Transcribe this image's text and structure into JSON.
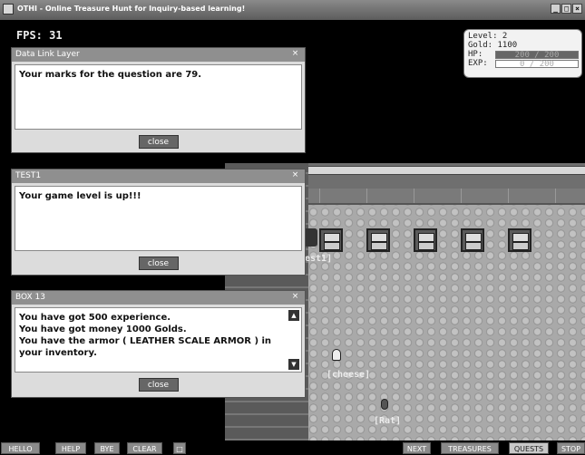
{
  "window": {
    "title": "OTHI - Online Treasure Hunt for Inquiry-based learning!",
    "min": "_",
    "max": "□",
    "close": "×"
  },
  "fps": "FPS: 31",
  "stats": {
    "level": "Level: 2",
    "gold": "Gold: 1100",
    "hp_label": "HP:",
    "hp_text": "200 / 200",
    "hp_fraction": 1.0,
    "exp_label": "EXP:",
    "exp_text": "0 / 200",
    "exp_fraction": 0.0
  },
  "dialogs": {
    "data_link": {
      "title": "Data Link Layer",
      "close_x": "×",
      "message": "Your marks for the question are 79.",
      "button": "close"
    },
    "test1": {
      "title": "TEST1",
      "close_x": "×",
      "message": "Your game level is up!!!",
      "button": "close"
    },
    "box13": {
      "title": "BOX 13",
      "close_x": "×",
      "lines": [
        "You have got 500 experience.",
        "You have got money 1000 Golds.",
        "You have the armor ( LEATHER SCALE ARMOR ) in your inventory."
      ],
      "button": "close",
      "scroll_up": "▲",
      "scroll_down": "▼"
    }
  },
  "map": {
    "player_label": "est1]",
    "cheese_label": "[cheese]",
    "rat_label": "[Rat]"
  },
  "toolbar": {
    "left": [
      "HELLO",
      "HELP",
      "BYE",
      "CLEAR",
      "□"
    ],
    "right": [
      "NEXT",
      "TREASURES",
      "QUESTS",
      "STOP"
    ],
    "active": "QUESTS"
  }
}
